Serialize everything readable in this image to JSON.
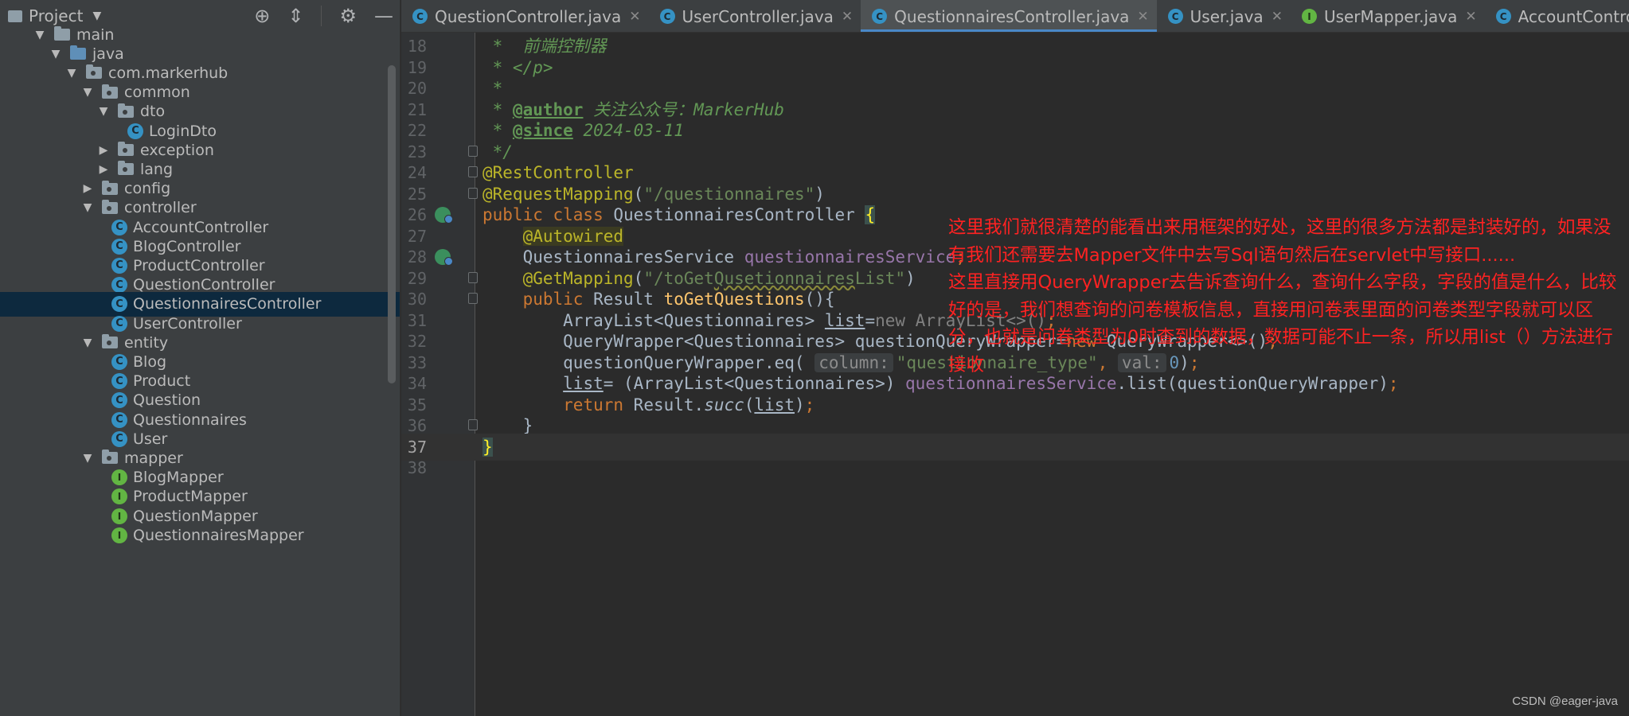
{
  "project_panel": {
    "title": "Project",
    "tree": [
      {
        "label": "main",
        "indent": 1,
        "arrow": "▼",
        "icon": "folder"
      },
      {
        "label": "java",
        "indent": 2,
        "arrow": "▼",
        "icon": "source-folder"
      },
      {
        "label": "com.markerhub",
        "indent": 3,
        "arrow": "▼",
        "icon": "package"
      },
      {
        "label": "common",
        "indent": 4,
        "arrow": "▼",
        "icon": "package"
      },
      {
        "label": "dto",
        "indent": 5,
        "arrow": "▼",
        "icon": "package"
      },
      {
        "label": "LoginDto",
        "indent": 6,
        "arrow": "",
        "icon": "class"
      },
      {
        "label": "exception",
        "indent": 5,
        "arrow": "▶",
        "icon": "package"
      },
      {
        "label": "lang",
        "indent": 5,
        "arrow": "▶",
        "icon": "package"
      },
      {
        "label": "config",
        "indent": 4,
        "arrow": "▶",
        "icon": "package"
      },
      {
        "label": "controller",
        "indent": 4,
        "arrow": "▼",
        "icon": "package"
      },
      {
        "label": "AccountController",
        "indent": 5,
        "arrow": "",
        "icon": "class"
      },
      {
        "label": "BlogController",
        "indent": 5,
        "arrow": "",
        "icon": "class"
      },
      {
        "label": "ProductController",
        "indent": 5,
        "arrow": "",
        "icon": "class"
      },
      {
        "label": "QuestionController",
        "indent": 5,
        "arrow": "",
        "icon": "class"
      },
      {
        "label": "QuestionnairesController",
        "indent": 5,
        "arrow": "",
        "icon": "class",
        "selected": true
      },
      {
        "label": "UserController",
        "indent": 5,
        "arrow": "",
        "icon": "class"
      },
      {
        "label": "entity",
        "indent": 4,
        "arrow": "▼",
        "icon": "package"
      },
      {
        "label": "Blog",
        "indent": 5,
        "arrow": "",
        "icon": "class"
      },
      {
        "label": "Product",
        "indent": 5,
        "arrow": "",
        "icon": "class"
      },
      {
        "label": "Question",
        "indent": 5,
        "arrow": "",
        "icon": "class"
      },
      {
        "label": "Questionnaires",
        "indent": 5,
        "arrow": "",
        "icon": "class"
      },
      {
        "label": "User",
        "indent": 5,
        "arrow": "",
        "icon": "class"
      },
      {
        "label": "mapper",
        "indent": 4,
        "arrow": "▼",
        "icon": "package"
      },
      {
        "label": "BlogMapper",
        "indent": 5,
        "arrow": "",
        "icon": "interface"
      },
      {
        "label": "ProductMapper",
        "indent": 5,
        "arrow": "",
        "icon": "interface"
      },
      {
        "label": "QuestionMapper",
        "indent": 5,
        "arrow": "",
        "icon": "interface"
      },
      {
        "label": "QuestionnairesMapper",
        "indent": 5,
        "arrow": "",
        "icon": "interface"
      }
    ]
  },
  "tabs": [
    {
      "label": "QuestionController.java",
      "icon": "class",
      "active": false
    },
    {
      "label": "UserController.java",
      "icon": "class",
      "active": false
    },
    {
      "label": "QuestionnairesController.java",
      "icon": "class",
      "active": true
    },
    {
      "label": "User.java",
      "icon": "class",
      "active": false
    },
    {
      "label": "UserMapper.java",
      "icon": "interface",
      "active": false
    },
    {
      "label": "AccountController.java",
      "icon": "class",
      "active": false
    },
    {
      "label": "A",
      "icon": "class",
      "active": false
    }
  ],
  "editor": {
    "current_line": 37,
    "lines": [
      {
        "n": 18,
        "html": "<span class=\"cm\"> *  前端控制器</span>"
      },
      {
        "n": 19,
        "html": "<span class=\"cm\"> * &lt;/p&gt;</span>"
      },
      {
        "n": 20,
        "html": "<span class=\"cm\"> *</span>"
      },
      {
        "n": 21,
        "html": "<span class=\"cm\"> * </span><span class=\"tag\">@author</span><span class=\"cm\"> 关注公众号：MarkerHub</span>"
      },
      {
        "n": 22,
        "html": "<span class=\"cm\"> * </span><span class=\"tag\">@since</span><span class=\"cm\"> 2024-03-11</span>"
      },
      {
        "n": 23,
        "html": "<span class=\"cm\"> */</span>",
        "fold": true
      },
      {
        "n": 24,
        "html": "<span class=\"an\">@RestController</span>",
        "fold": true
      },
      {
        "n": 25,
        "html": "<span class=\"an\">@RequestMapping</span>(<span class=\"st\">\"/questionnaires\"</span>)",
        "fold": true
      },
      {
        "n": 26,
        "html": "<span class=\"kw\">public class </span>QuestionnairesController <span class=\"brace-hl\">{</span>",
        "gutter_icon": "bean"
      },
      {
        "n": 27,
        "html": "    <span class=\"an-hl\">@Autowired</span>"
      },
      {
        "n": 28,
        "html": "    QuestionnairesService <span class=\"fld\">questionnairesService</span><span class=\"kw\">;</span>",
        "gutter_icon": "bean"
      },
      {
        "n": 29,
        "html": "    <span class=\"an\">@GetMapping</span>(<span class=\"st\">\"/toGet<span class=\"wavy\">Qusetionnaires</span>List\"</span>)",
        "fold": true
      },
      {
        "n": 30,
        "html": "    <span class=\"kw\">public </span>Result <span class=\"fn\">toGetQuestions</span>(){",
        "fold": true
      },
      {
        "n": 31,
        "html": "        ArrayList&lt;Questionnaires&gt; <span class=\"ul\">list</span>=<span class=\"gray\">new ArrayList&lt;&gt;()</span><span class=\"kw\">;</span>"
      },
      {
        "n": 32,
        "html": "        QueryWrapper&lt;Questionnaires&gt; questionQueryWrapper=<span class=\"kw\">new </span>QueryWrapper&lt;&gt;()<span class=\"kw\">;</span>"
      },
      {
        "n": 33,
        "html": "        questionQueryWrapper.eq( <span class=\"hint\">column:</span><span class=\"st\">\"questionnaire_type\"</span><span class=\"kw\">, </span><span class=\"hint\">val:</span><span class=\"num\">0</span>)<span class=\"kw\">;</span>"
      },
      {
        "n": 34,
        "html": "        <span class=\"ul\">list</span>= (ArrayList&lt;Questionnaires&gt;) <span class=\"fld\">questionnairesService</span>.list(questionQueryWrapper)<span class=\"kw\">;</span>"
      },
      {
        "n": 35,
        "html": "        <span class=\"kw\">return </span>Result.<span class=\"it\">succ</span>(<span class=\"ul\">list</span>)<span class=\"kw\">;</span>"
      },
      {
        "n": 36,
        "html": "    }",
        "fold": true
      },
      {
        "n": 37,
        "html": "<span class=\"brace-hl\">}</span>",
        "current": true
      },
      {
        "n": 38,
        "html": ""
      }
    ]
  },
  "annotation": {
    "paragraphs": [
      "这里我们就很清楚的能看出来用框架的好处，这里的很多方法都是封装好的，如果没有我们还需要去Mapper文件中去写Sql语句然后在servlet中写接口......",
      "这里直接用QueryWrapper去告诉查询什么，查询什么字段，字段的值是什么，比较好的是，我们想查询的问卷模板信息，直接用问卷表里面的问卷类型字段就可以区分，也就是问卷类型为0时查到的数据，数据可能不止一条，所以用list（）方法进行接收"
    ]
  },
  "watermark": "CSDN @eager-java"
}
